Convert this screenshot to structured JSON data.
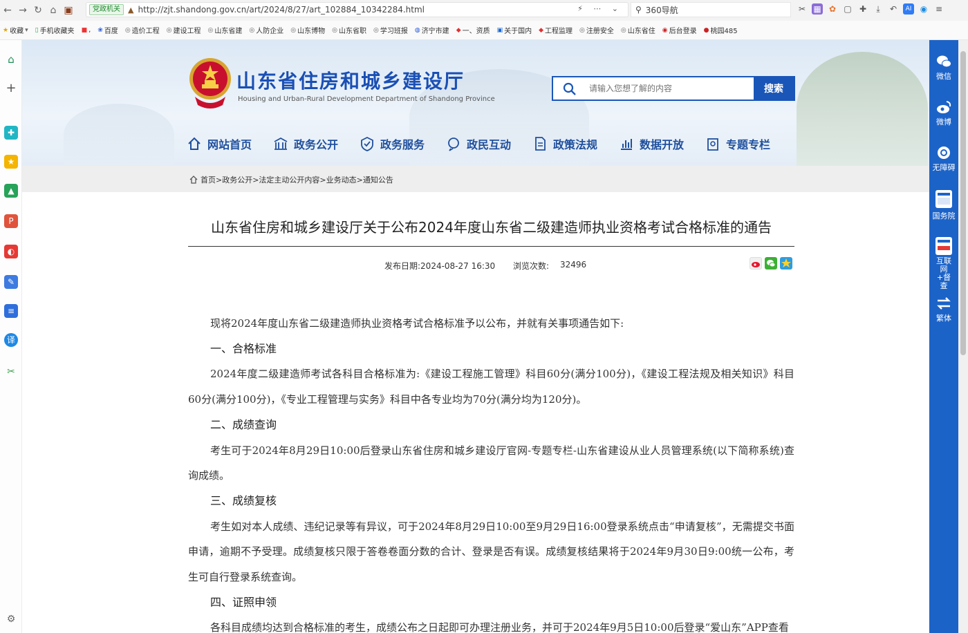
{
  "browser": {
    "gov_badge": "党政机关",
    "url": "http://zjt.shandong.gov.cn/art/2024/8/27/art_102884_10342284.html",
    "search_placeholder": "360导航",
    "url_right": "⚡ ⋯ ⌄"
  },
  "bookmarks": [
    "收藏",
    "手机收藏夹",
    "百度",
    "造价工程",
    "建设工程",
    "山东省建",
    "人防企业",
    "山东博物",
    "山东省职",
    "学习班报",
    "济宁市建",
    "一、资质",
    "关于国内",
    "工程监理",
    "注册安全",
    "山东省住",
    "后台登录",
    "桃园485"
  ],
  "site": {
    "title": "山东省住房和城乡建设厅",
    "subtitle": "Housing and Urban-Rural Development Department of Shandong Province",
    "search_placeholder": "请输入您想了解的内容",
    "search_button": "搜索",
    "nav": [
      "网站首页",
      "政务公开",
      "政务服务",
      "政民互动",
      "政策法规",
      "数据开放",
      "专题专栏"
    ]
  },
  "breadcrumb": "首页>政务公开>法定主动公开内容>业务动态>通知公告",
  "article": {
    "title": "山东省住房和城乡建设厅关于公布2024年度山东省二级建造师执业资格考试合格标准的通告",
    "date": "发布日期:2024-08-27 16:30",
    "views_label": "浏览次数:",
    "views_value": "32496",
    "intro": "现将2024年度山东省二级建造师执业资格考试合格标准予以公布，并就有关事项通告如下:",
    "sections": [
      {
        "heading": "一、合格标准",
        "text": "2024年度二级建造师考试各科目合格标准为:《建设工程施工管理》科目60分(满分100分)，《建设工程法规及相关知识》科目60分(满分100分)，《专业工程管理与实务》科目中各专业均为70分(满分均为120分)。"
      },
      {
        "heading": "二、成绩查询",
        "text": "考生可于2024年8月29日10:00后登录山东省住房和城乡建设厅官网-专题专栏-山东省建设从业人员管理系统(以下简称系统)查询成绩。"
      },
      {
        "heading": "三、成绩复核",
        "text": "考生如对本人成绩、违纪记录等有异议，可于2024年8月29日10:00至9月29日16:00登录系统点击“申请复核”，无需提交书面申请，逾期不予受理。成绩复核只限于答卷卷面分数的合计、登录是否有误。成绩复核结果将于2024年9月30日9:00统一公布，考生可自行登录系统查询。"
      },
      {
        "heading": "四、证照申领",
        "text": "各科目成绩均达到合格标准的考生，成绩公布之日起即可办理注册业务，并可于2024年9月5日10:00后登录“爱山东”APP查看"
      }
    ]
  },
  "right_bar": {
    "wechat": "微信",
    "weibo": "微博",
    "accessibility": "无障碍",
    "state_council": "国务院",
    "internet_supervision": "互联网+督查",
    "traditional": "繁体"
  },
  "colors": {
    "brand_blue": "#1a56b8",
    "nav_blue": "#1f4f9d",
    "right_bar": "#1c63c8"
  }
}
